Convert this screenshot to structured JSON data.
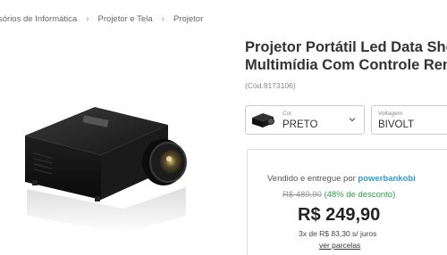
{
  "breadcrumb": {
    "items": [
      "sórios de Informática",
      "Projetor e Tela",
      "Projetor"
    ]
  },
  "product": {
    "title_line1": "Projetor Portátil Led Data Show",
    "title_line2": "Multimídia Com Controle Remot",
    "sku": "(Cód.9173106)"
  },
  "options": {
    "color_label": "Cor",
    "color_value": "PRETO",
    "voltage_label": "Voltagem",
    "voltage_value": "BIVOLT"
  },
  "buy_box": {
    "seller_prefix": "Vendido e entregue por",
    "seller_name": "powerbankobi",
    "old_price": "R$ 489,90",
    "discount": "(48% de desconto)",
    "price": "R$ 249,90",
    "installments": "3x de R$ 83,30 s/ juros",
    "installments_link": "ver parcelas"
  },
  "colors": {
    "seller_link": "#2f9bd3",
    "discount": "#2a9d4b",
    "price": "#222222"
  },
  "icons": [
    "chevron-right-icon",
    "chevron-down-icon",
    "projector-thumbnail"
  ]
}
